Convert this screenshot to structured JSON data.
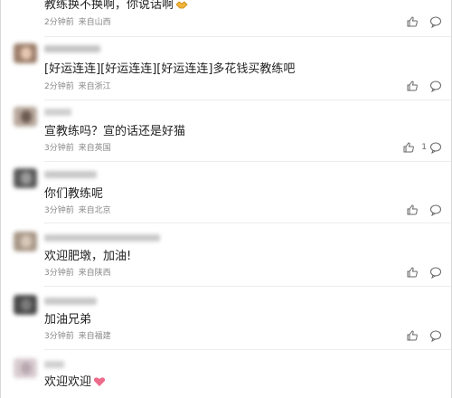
{
  "comments": [
    {
      "text": "教练换不换啊，你说话啊",
      "emoji": "handshake-emoji",
      "time": "2分钟前",
      "location": "来自山西",
      "likes": ""
    },
    {
      "text": "[好运连连][好运连连][好运连连]多花钱买教练吧",
      "time": "2分钟前",
      "location": "来自浙江",
      "likes": ""
    },
    {
      "text": "宣教练吗？宣的话还是好猫",
      "time": "3分钟前",
      "location": "来自英国",
      "likes": "1"
    },
    {
      "text": "你们教练呢",
      "time": "3分钟前",
      "location": "来自北京",
      "likes": ""
    },
    {
      "text": "欢迎肥墩，加油!",
      "time": "3分钟前",
      "location": "来自陕西",
      "likes": ""
    },
    {
      "text": "加油兄弟",
      "time": "3分钟前",
      "location": "来自福建",
      "likes": ""
    },
    {
      "text": "欢迎欢迎",
      "emoji": "heart-emoji",
      "time": "",
      "location": "",
      "likes": ""
    }
  ],
  "icons": {
    "like": "thumbs-up-icon",
    "reply": "comment-bubble-icon"
  },
  "colors": {
    "meta_text": "#888888",
    "icon_stroke": "#666666",
    "divider": "#ececec"
  }
}
